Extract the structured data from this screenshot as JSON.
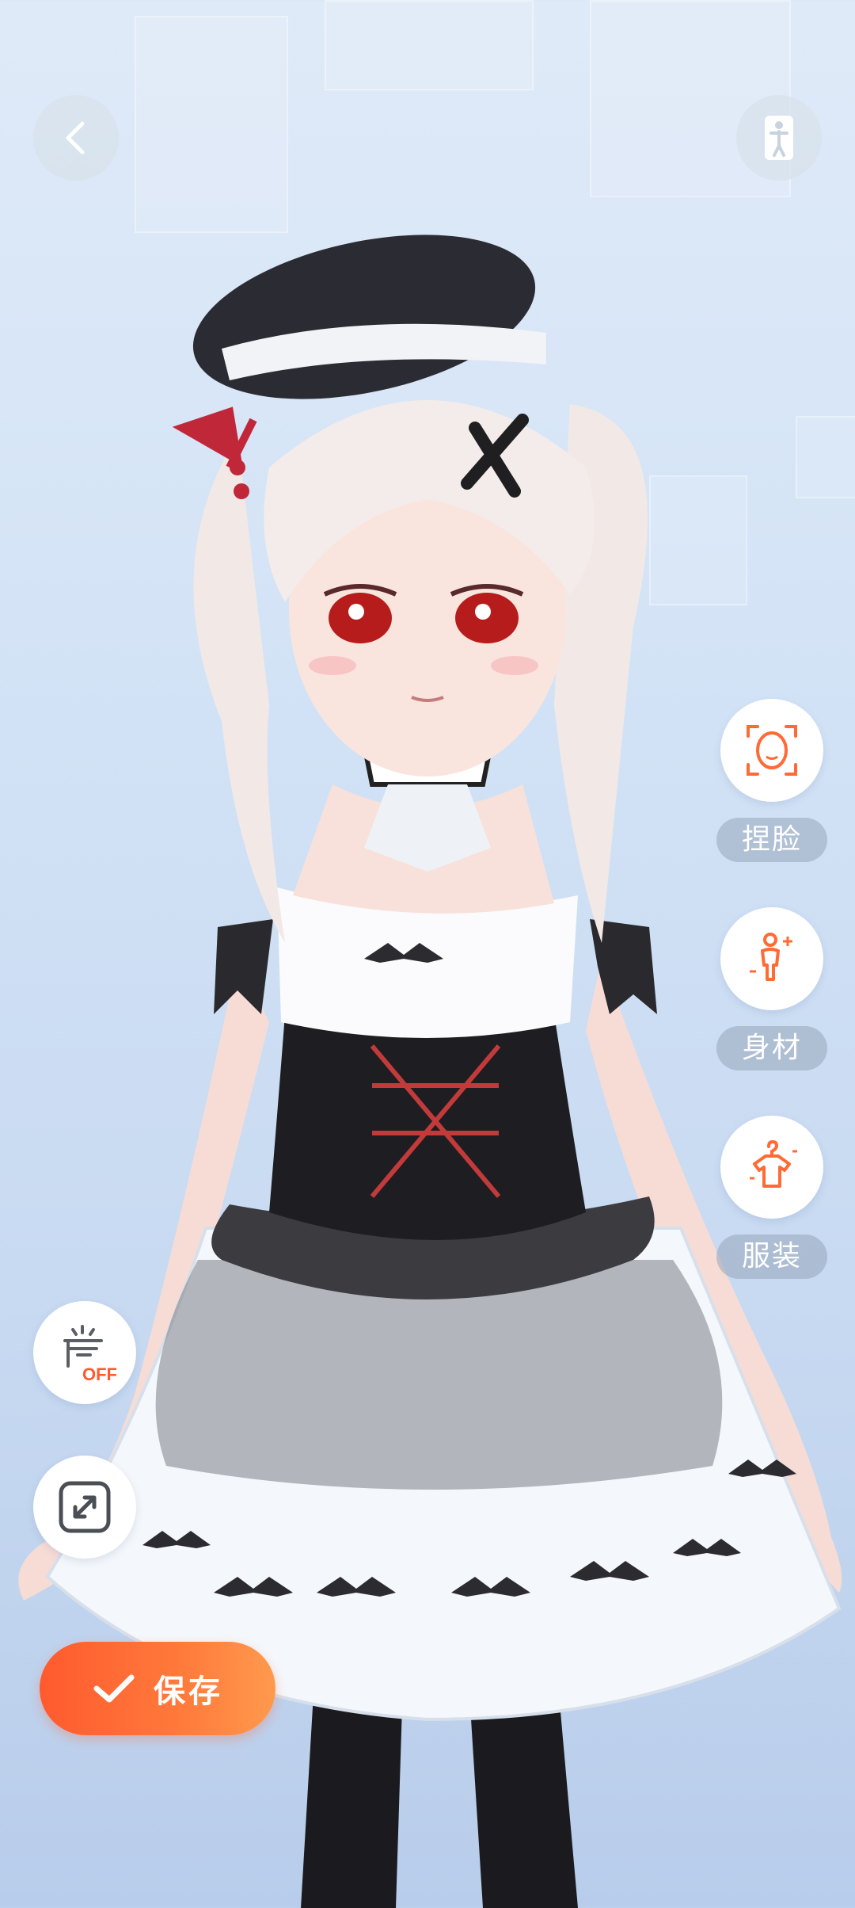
{
  "top_bar": {
    "back_icon": "chevron-left-icon",
    "pose_icon": "standing-figure-icon"
  },
  "side_menu": [
    {
      "label": "捏脸",
      "icon": "face-scan-icon"
    },
    {
      "label": "身材",
      "icon": "body-figure-icon"
    },
    {
      "label": "服装",
      "icon": "hanger-shirt-icon"
    }
  ],
  "tools": {
    "background_toggle": {
      "icon": "light-box-icon",
      "state": "OFF"
    },
    "expand_icon": "expand-arrows-icon"
  },
  "save_button": {
    "label": "保存",
    "icon": "check-icon"
  },
  "colors": {
    "accent": "#ff6a35",
    "accent_light": "#ff9a4d",
    "label_bg": "#96a5b9",
    "bg_top": "#dfeaf8",
    "bg_bottom": "#b8cdeb"
  }
}
